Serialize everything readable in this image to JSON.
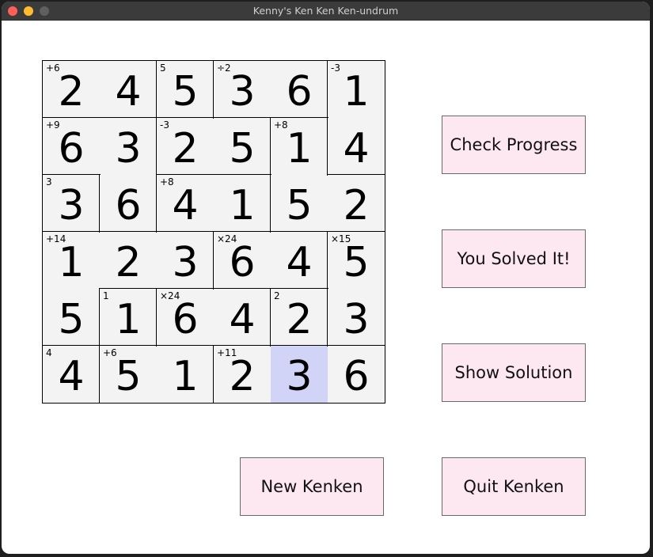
{
  "window": {
    "title": "Kenny's Ken Ken Ken-undrum"
  },
  "grid": {
    "size": 6,
    "values": [
      [
        2,
        4,
        5,
        3,
        6,
        1
      ],
      [
        6,
        3,
        2,
        5,
        1,
        4
      ],
      [
        3,
        6,
        4,
        1,
        5,
        2
      ],
      [
        1,
        2,
        3,
        6,
        4,
        5
      ],
      [
        5,
        1,
        6,
        4,
        2,
        3
      ],
      [
        4,
        5,
        1,
        2,
        3,
        6
      ]
    ],
    "clues": [
      [
        "+6",
        "",
        "5",
        "÷2",
        "",
        "-3"
      ],
      [
        "+9",
        "",
        "-3",
        "",
        "+8",
        ""
      ],
      [
        "3",
        "",
        "+8",
        "",
        "",
        ""
      ],
      [
        "+14",
        "",
        "",
        "×24",
        "",
        "×15"
      ],
      [
        "",
        "1",
        "×24",
        "",
        "2",
        ""
      ],
      [
        "4",
        "+6",
        "",
        "+11",
        "",
        ""
      ]
    ],
    "cages": [
      [
        "A",
        "A",
        "B",
        "C",
        "C",
        "D"
      ],
      [
        "E",
        "E",
        "F",
        "F",
        "G",
        "D"
      ],
      [
        "H",
        "E",
        "I",
        "I",
        "G",
        "G"
      ],
      [
        "J",
        "J",
        "J",
        "K",
        "K",
        "L"
      ],
      [
        "J",
        "M",
        "N",
        "N",
        "O",
        "L"
      ],
      [
        "P",
        "Q",
        "Q",
        "R",
        "R",
        "R"
      ]
    ],
    "selected": [
      5,
      4
    ]
  },
  "buttons": {
    "check_progress": "Check Progress",
    "you_solved_it": "You Solved It!",
    "show_solution": "Show Solution",
    "new_kenken": "New Kenken",
    "quit_kenken": "Quit Kenken"
  }
}
